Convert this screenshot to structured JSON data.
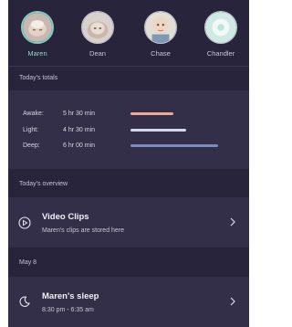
{
  "profiles": [
    {
      "name": "Maren",
      "selected": true
    },
    {
      "name": "Dean",
      "selected": false
    },
    {
      "name": "Chase",
      "selected": false
    },
    {
      "name": "Chandler",
      "selected": false
    }
  ],
  "totals": {
    "section_label": "Today's totals",
    "rows": [
      {
        "label": "Awake:",
        "value": "5 hr 30 min",
        "fraction": 0.49,
        "color": "#f0a88f"
      },
      {
        "label": "Light:",
        "value": "4 hr 30 min",
        "fraction": 0.64,
        "color": "#d3d6ee"
      },
      {
        "label": "Deep:",
        "value": "6 hr 00 min",
        "fraction": 1.0,
        "color": "#7f87c0"
      }
    ]
  },
  "overview": {
    "section_label": "Today's overview",
    "video_clips": {
      "title": "Video Clips",
      "subtitle": "Maren's clips are stored here",
      "icon": "play-circle-icon"
    }
  },
  "day": {
    "section_label": "May 8",
    "sleep": {
      "title": "Maren's sleep",
      "subtitle": "8:30 pm - 6:35 am",
      "icon": "moon-icon"
    }
  },
  "colors": {
    "background": "#28243b",
    "panel": "#342f48",
    "accent": "#7ecfc1"
  }
}
